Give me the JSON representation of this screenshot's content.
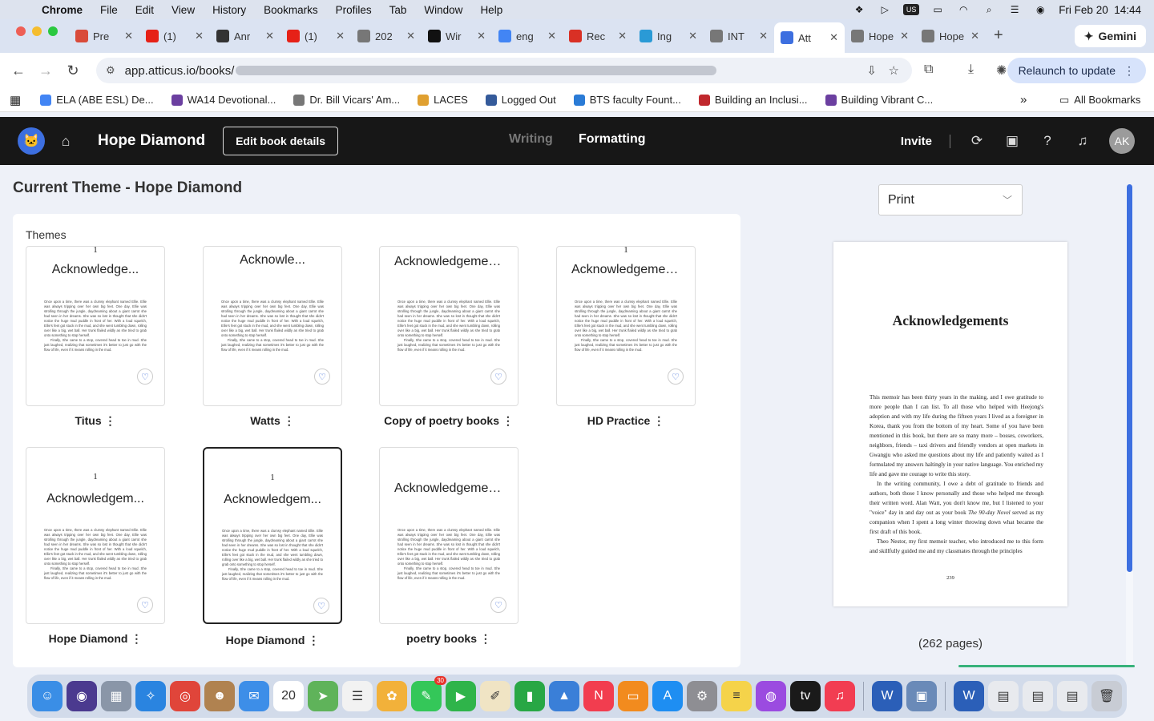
{
  "menubar": {
    "app": "Chrome",
    "items": [
      "File",
      "Edit",
      "View",
      "History",
      "Bookmarks",
      "Profiles",
      "Tab",
      "Window",
      "Help"
    ],
    "clock": "Fri Feb 20  14:44",
    "input_source": "US"
  },
  "tabs": [
    {
      "label": "Pre",
      "color": "#d94b3a"
    },
    {
      "label": "(1)",
      "color": "#e62117"
    },
    {
      "label": "Anr",
      "color": "#333333"
    },
    {
      "label": "(1)",
      "color": "#e62117"
    },
    {
      "label": "202",
      "color": "#777777"
    },
    {
      "label": "Wir",
      "color": "#111111"
    },
    {
      "label": "eng",
      "color": "#4285f4"
    },
    {
      "label": "Rec",
      "color": "#d93025"
    },
    {
      "label": "Ing",
      "color": "#2a9ad6"
    },
    {
      "label": "INT",
      "color": "#777777"
    },
    {
      "label": "Att",
      "color": "#3d6fe0",
      "active": true
    },
    {
      "label": "Hope D",
      "color": "#777777"
    },
    {
      "label": "Hope D",
      "color": "#777777"
    }
  ],
  "gemini": "Gemini",
  "address": {
    "url": "app.atticus.io/books/"
  },
  "relaunch": "Relaunch to update",
  "bookmarks": [
    {
      "label": "ELA (ABE ESL) De...",
      "color": "#4285f4"
    },
    {
      "label": "WA14 Devotional...",
      "color": "#6b3fa0"
    },
    {
      "label": "Dr. Bill Vicars' Am...",
      "color": "#777777"
    },
    {
      "label": "LACES",
      "color": "#e0a030"
    },
    {
      "label": "Logged Out",
      "color": "#345a9a"
    },
    {
      "label": "BTS faculty Fount...",
      "color": "#2a7bd6"
    },
    {
      "label": "Building an Inclusi...",
      "color": "#c0282d"
    },
    {
      "label": "Building Vibrant C...",
      "color": "#6b3fa0"
    }
  ],
  "all_bookmarks": "All Bookmarks",
  "app": {
    "book_title": "Hope Diamond",
    "edit_button": "Edit book details",
    "nav_writing": "Writing",
    "nav_formatting": "Formatting",
    "invite": "Invite",
    "avatar_initials": "AK"
  },
  "page": {
    "heading": "Current Theme - Hope Diamond",
    "themes_label": "Themes"
  },
  "theme_sample_text": {
    "page_number": "1",
    "para1": "Once upon a time, there was a clumsy elephant named Ellie. Ellie was always tripping over her own big feet. One day, Ellie was strolling through the jungle, daydreaming about a giant carrot she had seen in her dreams. She was so lost in thought that she didn't notice the huge mud puddle in front of her. With a loud squelch, Ellie's feet got stuck in the mud, and she went tumbling down, rolling over like a big, wet ball. Her trunk flailed wildly as she tried to grab onto something to stop herself.",
    "para2": "Finally, She came to a stop, covered head to toe in mud. She just laughed, realizing that sometimes it's better to just go with the flow of life, even if it means rolling in the mud."
  },
  "themes": [
    {
      "name": "Titus ⋮",
      "title": "Acknowledge...",
      "style": "titus",
      "show_number": true
    },
    {
      "name": "Watts ⋮",
      "title": "Acknowle...",
      "style": "watts",
      "show_number": false
    },
    {
      "name": "Copy of poetry books ⋮",
      "title": "Acknowledgements",
      "style": "script",
      "show_number": false
    },
    {
      "name": "HD Practice ⋮",
      "title": "Acknowledgements",
      "style": "serif",
      "show_number": true
    },
    {
      "name": "Hope Diamond ⋮",
      "title": "Acknowledgem...",
      "style": "serif",
      "show_number": true
    },
    {
      "name": "Hope Diamond ⋮",
      "title": "Acknowledgem...",
      "style": "serif",
      "show_number": true,
      "selected": true
    },
    {
      "name": "poetry books ⋮",
      "title": "Acknowledgements",
      "style": "script",
      "show_number": false
    }
  ],
  "preview": {
    "format": "Print",
    "title": "Acknowledgements",
    "para1": "This memoir has been thirty years in the making, and I owe gratitude to more people than I can list. To all those who helped with Heejong's adoption and with my life during the fifteen years I lived as a foreigner in Korea, thank you from the bottom of my heart. Some of you have been mentioned in this book, but there are so many more – bosses, coworkers, neighbors, friends – taxi drivers and friendly vendors at open markets in Gwangju who asked me questions about my life and patiently waited as I formulated my answers haltingly in your native language. You enriched my life and gave me courage to write this story.",
    "para2a": "In the writing community, I owe a debt of gratitude to friends and authors, both those I know personally and those who helped me through their written word. Alan Watt, you don't know me, but I listened to your \"voice\" day in and day out as your book ",
    "para2_italic": "The 90-day Novel",
    "para2b": " served as my companion when I spent a long winter throwing down what became the first draft of this book.",
    "para3": "Theo Nestor, my first memoir teacher, who introduced me to this form and skillfully guided me and my classmates through the principles",
    "page_number": "239",
    "page_count": "(262 pages)"
  },
  "dock": [
    {
      "name": "finder",
      "color": "#3a8ee6",
      "glyph": "☺"
    },
    {
      "name": "siri",
      "color": "#4b3a8f",
      "glyph": "◉"
    },
    {
      "name": "launchpad",
      "color": "#8a96a8",
      "glyph": "▦"
    },
    {
      "name": "safari",
      "color": "#2a84e0",
      "glyph": "✧"
    },
    {
      "name": "chrome",
      "color": "#e0453a",
      "glyph": "◎"
    },
    {
      "name": "contacts",
      "color": "#b08250",
      "glyph": "☻"
    },
    {
      "name": "mail",
      "color": "#3d8ee8",
      "glyph": "✉"
    },
    {
      "name": "calendar",
      "color": "#ffffff",
      "glyph": "20"
    },
    {
      "name": "maps",
      "color": "#5fb35a",
      "glyph": "➤"
    },
    {
      "name": "reminders",
      "color": "#f2f2f2",
      "glyph": "☰"
    },
    {
      "name": "photos",
      "color": "#f2b13a",
      "glyph": "✿"
    },
    {
      "name": "messages",
      "color": "#34c759",
      "glyph": "✎",
      "badge": "30"
    },
    {
      "name": "facetime",
      "color": "#2fb44a",
      "glyph": "▶"
    },
    {
      "name": "textedit",
      "color": "#f0e4c4",
      "glyph": "✐"
    },
    {
      "name": "numbers",
      "color": "#28a745",
      "glyph": "▮"
    },
    {
      "name": "keynote",
      "color": "#3a7fd8",
      "glyph": "▲"
    },
    {
      "name": "news",
      "color": "#f23d4f",
      "glyph": "N"
    },
    {
      "name": "books",
      "color": "#f28b1e",
      "glyph": "▭"
    },
    {
      "name": "app-store",
      "color": "#1e8ef2",
      "glyph": "A"
    },
    {
      "name": "system-settings",
      "color": "#8e8e93",
      "glyph": "⚙"
    },
    {
      "name": "notes",
      "color": "#f5d34a",
      "glyph": "≡"
    },
    {
      "name": "podcasts",
      "color": "#9b4be0",
      "glyph": "◍"
    },
    {
      "name": "apple-tv",
      "color": "#1a1a1a",
      "glyph": "tv"
    },
    {
      "name": "music",
      "color": "#f23d52",
      "glyph": "♫"
    },
    {
      "name": "word",
      "color": "#2b5fb8",
      "glyph": "W"
    },
    {
      "name": "preview",
      "color": "#6a8ab8",
      "glyph": "▣"
    },
    {
      "name": "word-doc",
      "color": "#2b5fb8",
      "glyph": "W"
    },
    {
      "name": "screenshot",
      "color": "#e8eaee",
      "glyph": "▤"
    },
    {
      "name": "file",
      "color": "#e8eaee",
      "glyph": "▤"
    },
    {
      "name": "file2",
      "color": "#e8eaee",
      "glyph": "▤"
    },
    {
      "name": "trash",
      "color": "#c8ccd4",
      "glyph": "🗑"
    }
  ]
}
